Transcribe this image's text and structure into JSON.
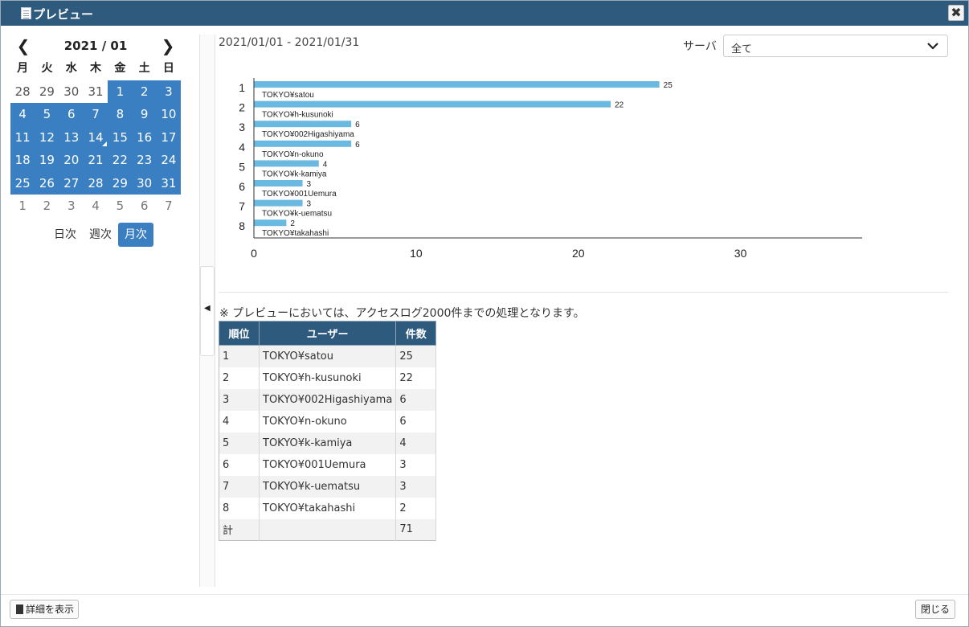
{
  "window": {
    "title": "プレビュー",
    "close_glyph": "✖"
  },
  "calendar": {
    "prev_glyph": "❮",
    "next_glyph": "❯",
    "month": "2021 / 01",
    "weekdays": [
      "月",
      "火",
      "水",
      "木",
      "金",
      "土",
      "日"
    ],
    "days": [
      "28",
      "29",
      "30",
      "31",
      "1",
      "2",
      "3",
      "4",
      "5",
      "6",
      "7",
      "8",
      "9",
      "10",
      "11",
      "12",
      "13",
      "14",
      "15",
      "16",
      "17",
      "18",
      "19",
      "20",
      "21",
      "22",
      "23",
      "24",
      "25",
      "26",
      "27",
      "28",
      "29",
      "30",
      "31",
      "1",
      "2",
      "3",
      "4",
      "5",
      "6",
      "7"
    ],
    "selected_from_index": 4,
    "selected_to_index": 34,
    "today_index": 17
  },
  "period": {
    "daily": "日次",
    "weekly": "週次",
    "monthly": "月次",
    "active": "monthly"
  },
  "range": "2021/01/01 - 2021/01/31",
  "server": {
    "label": "サーバ",
    "value": "全て"
  },
  "chart_data": {
    "type": "bar",
    "orientation": "horizontal",
    "ranks": [
      "1",
      "2",
      "3",
      "4",
      "5",
      "6",
      "7",
      "8"
    ],
    "categories": [
      "TOKYO¥satou",
      "TOKYO¥h-kusunoki",
      "TOKYO¥002Higashiyama",
      "TOKYO¥n-okuno",
      "TOKYO¥k-kamiya",
      "TOKYO¥001Uemura",
      "TOKYO¥k-uematsu",
      "TOKYO¥takahashi"
    ],
    "values": [
      25,
      22,
      6,
      6,
      4,
      3,
      3,
      2
    ],
    "xticks": [
      "0",
      "10",
      "20",
      "30"
    ],
    "xlim": [
      0,
      37.5
    ],
    "bar_color": "#6ab9e0",
    "grid": false
  },
  "note": "※ プレビューにおいては、アクセスログ2000件までの処理となります。",
  "table": {
    "headers": [
      "順位",
      "ユーザー",
      "件数"
    ],
    "rows": [
      [
        "1",
        "TOKYO¥satou",
        "25"
      ],
      [
        "2",
        "TOKYO¥h-kusunoki",
        "22"
      ],
      [
        "3",
        "TOKYO¥002Higashiyama",
        "6"
      ],
      [
        "4",
        "TOKYO¥n-okuno",
        "6"
      ],
      [
        "5",
        "TOKYO¥k-kamiya",
        "4"
      ],
      [
        "6",
        "TOKYO¥001Uemura",
        "3"
      ],
      [
        "7",
        "TOKYO¥k-uematsu",
        "3"
      ],
      [
        "8",
        "TOKYO¥takahashi",
        "2"
      ]
    ],
    "total": [
      "計",
      "",
      "71"
    ]
  },
  "footer": {
    "detail_button": "詳細を表示",
    "close_button": "閉じる"
  },
  "colors": {
    "header": "#2e5a7e",
    "accent": "#3a7fc1",
    "bar": "#6ab9e0"
  }
}
